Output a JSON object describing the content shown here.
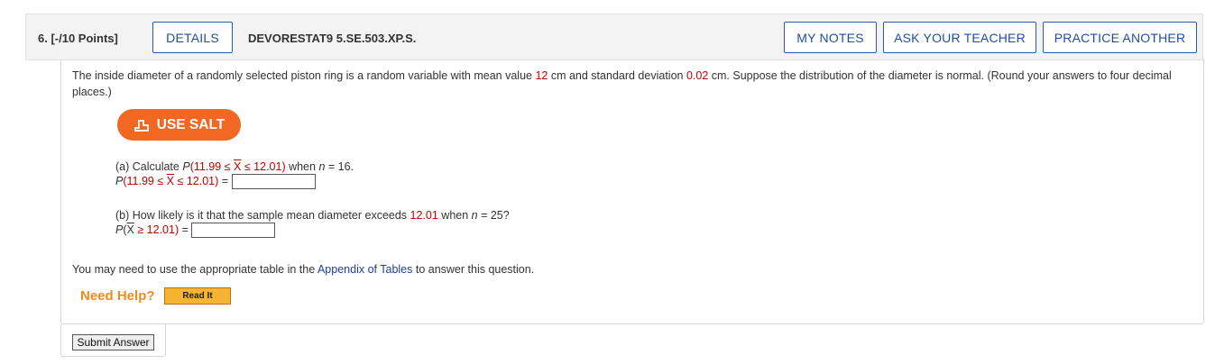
{
  "header": {
    "question_number": "6.",
    "points": "[-/10 Points]",
    "details_label": "DETAILS",
    "problem_code": "DEVORESTAT9 5.SE.503.XP.S.",
    "my_notes_label": "MY NOTES",
    "ask_teacher_label": "ASK YOUR TEACHER",
    "practice_another_label": "PRACTICE ANOTHER"
  },
  "question": {
    "stem_1": "The inside diameter of a randomly selected piston ring is a random variable with mean value ",
    "mean": "12",
    "stem_2": " cm and standard deviation ",
    "sd": "0.02",
    "stem_3": " cm. Suppose the distribution of the diameter is normal. (Round your answers to four decimal places.)"
  },
  "salt_button": {
    "label": "USE SALT",
    "icon": "salt-chart-icon"
  },
  "part_a": {
    "prompt_start": "(a) Calculate ",
    "p": "P",
    "interval_open": "(11.99 ≤ ",
    "xbar": "X",
    "interval_close": " ≤ 12.01)",
    "when_n": " when ",
    "n_var": "n",
    "n_value": " = 16.",
    "answer_eq": " =",
    "answer_value": ""
  },
  "part_b": {
    "prompt_start": "(b) How likely is it that the sample mean diameter exceeds ",
    "threshold": "12.01",
    "when_n": " when ",
    "n_var": "n",
    "n_value": " = 25?",
    "p": "P",
    "paren_open": "(",
    "xbar": "X",
    "inequality": " ≥ 12.01)",
    "answer_eq": " =",
    "answer_value": ""
  },
  "note": {
    "text_1": "You may need to use the appropriate table in the ",
    "link": "Appendix of Tables",
    "text_2": " to answer this question."
  },
  "help": {
    "label": "Need Help?",
    "read_it_label": "Read It"
  },
  "submit_label": "Submit Answer",
  "colors": {
    "accent": "#1f4e9e",
    "salt": "#f26722",
    "value_red": "#c00000",
    "help_orange": "#f08a1c"
  }
}
